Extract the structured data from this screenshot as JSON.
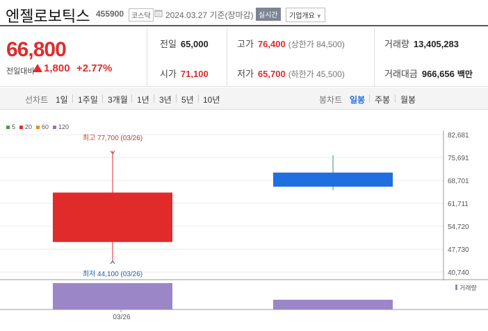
{
  "header": {
    "name": "엔젤로보틱스",
    "code": "455900",
    "market": "코스닥",
    "date": "2024.03.27",
    "basis": "기준(장마감)",
    "realtime_label": "실시간",
    "company_info_label": "기업개요"
  },
  "quote": {
    "price": "66,800",
    "change_label": "전일대비",
    "change_value": "1,800",
    "change_pct": "+2.77%",
    "prev_label": "전일",
    "prev_value": "65,000",
    "open_label": "시가",
    "open_value": "71,100",
    "high_label": "고가",
    "high_value": "76,400",
    "upper_limit": "(상한가 84,500)",
    "low_label": "저가",
    "low_value": "65,700",
    "lower_limit": "(하한가 45,500)",
    "volume_label": "거래량",
    "volume_value": "13,405,283",
    "amount_label": "거래대금",
    "amount_value": "966,656",
    "amount_unit": "백만"
  },
  "tabs": {
    "line_label": "선차트",
    "line_items": [
      "1일",
      "1주일",
      "3개월",
      "1년",
      "3년",
      "5년",
      "10년"
    ],
    "candle_label": "봉차트",
    "candle_items": [
      "일봉",
      "주봉",
      "월봉"
    ],
    "candle_active": "일봉"
  },
  "legend": [
    {
      "label": "5",
      "color": "#3aa63a"
    },
    {
      "label": "20",
      "color": "#e03030"
    },
    {
      "label": "60",
      "color": "#f08a1e"
    },
    {
      "label": "120",
      "color": "#9b6fd0"
    }
  ],
  "colors": {
    "up": "#e12b2b",
    "down": "#1f6fe0",
    "volume": "#9b86c8"
  },
  "chart_data": {
    "type": "candlestick",
    "x": [
      "03/26",
      "03/27"
    ],
    "x_tick_labels": [
      "03/26"
    ],
    "open": [
      77700,
      71100
    ],
    "high": [
      77700,
      76400
    ],
    "low": [
      44100,
      65700
    ],
    "close": [
      65000,
      66800
    ],
    "body_open": [
      49900,
      71100
    ],
    "y_ticks": [
      "82,681",
      "75,691",
      "68,701",
      "61,711",
      "54,720",
      "47,730",
      "40,740"
    ],
    "ylim": [
      40740,
      82681
    ],
    "annotations": {
      "high_text": "최고 77,700 (03/26)",
      "low_text": "최저 44,100 (03/26)"
    },
    "volume": {
      "label": "거래량",
      "values": [
        1.0,
        0.37
      ]
    }
  }
}
